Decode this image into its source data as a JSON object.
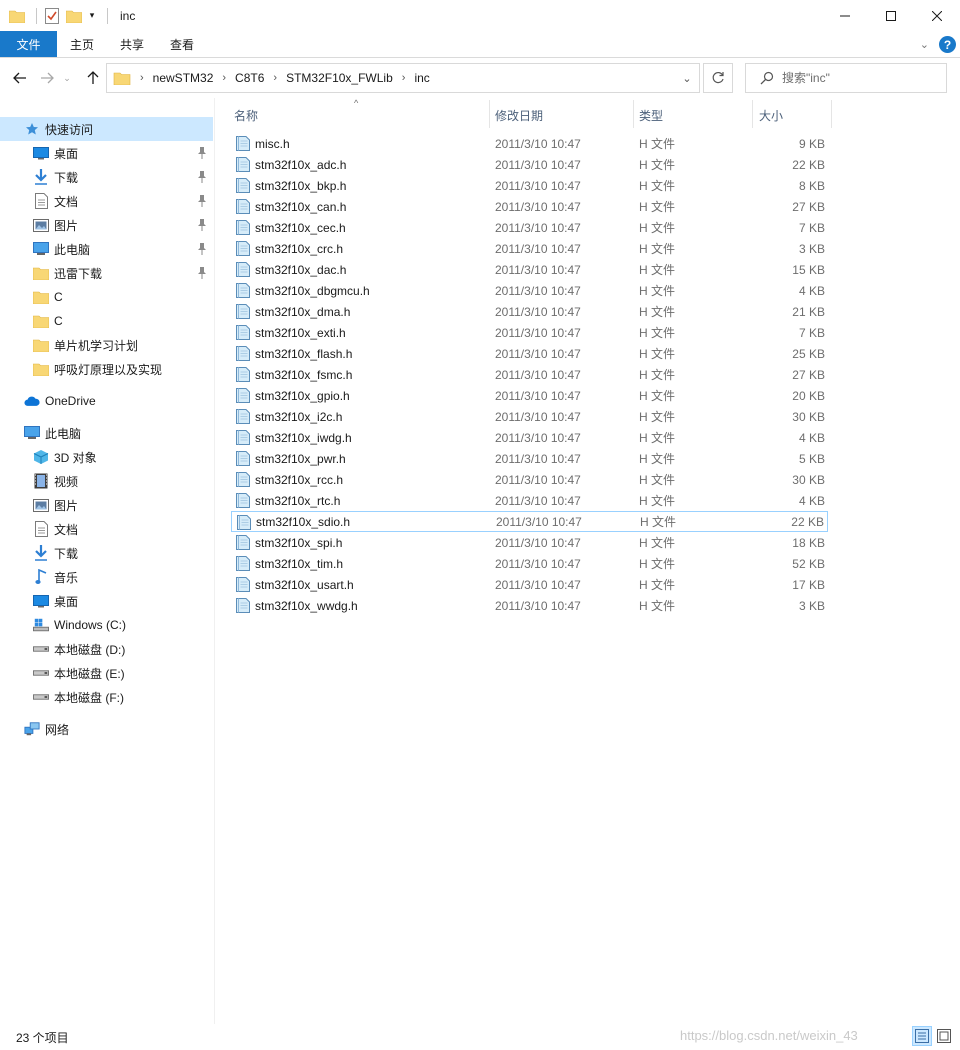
{
  "window": {
    "title": "inc"
  },
  "ribbon": {
    "tabs": [
      "文件",
      "主页",
      "共享",
      "查看"
    ]
  },
  "address": {
    "crumbs": [
      "newSTM32",
      "C8T6",
      "STM32F10x_FWLib",
      "inc"
    ]
  },
  "search": {
    "placeholder": "搜索\"inc\""
  },
  "sidebar": {
    "items": [
      {
        "label": "快速访问",
        "icon": "star-icon",
        "level": 0,
        "pinned": false,
        "selected": true
      },
      {
        "label": "桌面",
        "icon": "desktop-icon",
        "level": 1,
        "pinned": true
      },
      {
        "label": "下载",
        "icon": "download-icon",
        "level": 1,
        "pinned": true
      },
      {
        "label": "文档",
        "icon": "document-icon",
        "level": 1,
        "pinned": true
      },
      {
        "label": "图片",
        "icon": "picture-icon",
        "level": 1,
        "pinned": true
      },
      {
        "label": "此电脑",
        "icon": "computer-icon",
        "level": 1,
        "pinned": true
      },
      {
        "label": "迅雷下载",
        "icon": "folder-icon",
        "level": 1,
        "pinned": true
      },
      {
        "label": "C",
        "icon": "folder-icon",
        "level": 1,
        "pinned": false
      },
      {
        "label": "C",
        "icon": "folder-icon",
        "level": 1,
        "pinned": false
      },
      {
        "label": "单片机学习计划",
        "icon": "folder-icon",
        "level": 1,
        "pinned": false
      },
      {
        "label": "呼吸灯原理以及实现",
        "icon": "folder-icon",
        "level": 1,
        "pinned": false
      },
      {
        "label": "OneDrive",
        "icon": "cloud-icon",
        "level": 0,
        "pinned": false,
        "gap": true
      },
      {
        "label": "此电脑",
        "icon": "computer-icon",
        "level": 0,
        "pinned": false,
        "gap": true
      },
      {
        "label": "3D 对象",
        "icon": "cube-icon",
        "level": 1,
        "pinned": false
      },
      {
        "label": "视频",
        "icon": "video-icon",
        "level": 1,
        "pinned": false
      },
      {
        "label": "图片",
        "icon": "picture-icon",
        "level": 1,
        "pinned": false
      },
      {
        "label": "文档",
        "icon": "document-icon",
        "level": 1,
        "pinned": false
      },
      {
        "label": "下载",
        "icon": "download-icon",
        "level": 1,
        "pinned": false
      },
      {
        "label": "音乐",
        "icon": "music-icon",
        "level": 1,
        "pinned": false
      },
      {
        "label": "桌面",
        "icon": "desktop-icon",
        "level": 1,
        "pinned": false
      },
      {
        "label": "Windows (C:)",
        "icon": "windows-drive-icon",
        "level": 1,
        "pinned": false
      },
      {
        "label": "本地磁盘 (D:)",
        "icon": "drive-icon",
        "level": 1,
        "pinned": false
      },
      {
        "label": "本地磁盘 (E:)",
        "icon": "drive-icon",
        "level": 1,
        "pinned": false
      },
      {
        "label": "本地磁盘 (F:)",
        "icon": "drive-icon",
        "level": 1,
        "pinned": false
      },
      {
        "label": "网络",
        "icon": "network-icon",
        "level": 0,
        "pinned": false,
        "gap": true
      }
    ]
  },
  "columns": {
    "name": "名称",
    "date": "修改日期",
    "type": "类型",
    "size": "大小"
  },
  "files": [
    {
      "name": "misc.h",
      "date": "2011/3/10 10:47",
      "type": "H 文件",
      "size": "9 KB"
    },
    {
      "name": "stm32f10x_adc.h",
      "date": "2011/3/10 10:47",
      "type": "H 文件",
      "size": "22 KB"
    },
    {
      "name": "stm32f10x_bkp.h",
      "date": "2011/3/10 10:47",
      "type": "H 文件",
      "size": "8 KB"
    },
    {
      "name": "stm32f10x_can.h",
      "date": "2011/3/10 10:47",
      "type": "H 文件",
      "size": "27 KB"
    },
    {
      "name": "stm32f10x_cec.h",
      "date": "2011/3/10 10:47",
      "type": "H 文件",
      "size": "7 KB"
    },
    {
      "name": "stm32f10x_crc.h",
      "date": "2011/3/10 10:47",
      "type": "H 文件",
      "size": "3 KB"
    },
    {
      "name": "stm32f10x_dac.h",
      "date": "2011/3/10 10:47",
      "type": "H 文件",
      "size": "15 KB"
    },
    {
      "name": "stm32f10x_dbgmcu.h",
      "date": "2011/3/10 10:47",
      "type": "H 文件",
      "size": "4 KB"
    },
    {
      "name": "stm32f10x_dma.h",
      "date": "2011/3/10 10:47",
      "type": "H 文件",
      "size": "21 KB"
    },
    {
      "name": "stm32f10x_exti.h",
      "date": "2011/3/10 10:47",
      "type": "H 文件",
      "size": "7 KB"
    },
    {
      "name": "stm32f10x_flash.h",
      "date": "2011/3/10 10:47",
      "type": "H 文件",
      "size": "25 KB"
    },
    {
      "name": "stm32f10x_fsmc.h",
      "date": "2011/3/10 10:47",
      "type": "H 文件",
      "size": "27 KB"
    },
    {
      "name": "stm32f10x_gpio.h",
      "date": "2011/3/10 10:47",
      "type": "H 文件",
      "size": "20 KB"
    },
    {
      "name": "stm32f10x_i2c.h",
      "date": "2011/3/10 10:47",
      "type": "H 文件",
      "size": "30 KB"
    },
    {
      "name": "stm32f10x_iwdg.h",
      "date": "2011/3/10 10:47",
      "type": "H 文件",
      "size": "4 KB"
    },
    {
      "name": "stm32f10x_pwr.h",
      "date": "2011/3/10 10:47",
      "type": "H 文件",
      "size": "5 KB"
    },
    {
      "name": "stm32f10x_rcc.h",
      "date": "2011/3/10 10:47",
      "type": "H 文件",
      "size": "30 KB"
    },
    {
      "name": "stm32f10x_rtc.h",
      "date": "2011/3/10 10:47",
      "type": "H 文件",
      "size": "4 KB"
    },
    {
      "name": "stm32f10x_sdio.h",
      "date": "2011/3/10 10:47",
      "type": "H 文件",
      "size": "22 KB",
      "focused": true
    },
    {
      "name": "stm32f10x_spi.h",
      "date": "2011/3/10 10:47",
      "type": "H 文件",
      "size": "18 KB"
    },
    {
      "name": "stm32f10x_tim.h",
      "date": "2011/3/10 10:47",
      "type": "H 文件",
      "size": "52 KB"
    },
    {
      "name": "stm32f10x_usart.h",
      "date": "2011/3/10 10:47",
      "type": "H 文件",
      "size": "17 KB"
    },
    {
      "name": "stm32f10x_wwdg.h",
      "date": "2011/3/10 10:47",
      "type": "H 文件",
      "size": "3 KB"
    }
  ],
  "status": {
    "count": "23 个项目",
    "watermark": "https://blog.csdn.net/weixin_43"
  },
  "colors": {
    "accent": "#1979ca",
    "selected": "#cce8ff",
    "focusBorder": "#99d1ff",
    "header": "#4c607a",
    "muted": "#6d6d6d"
  }
}
